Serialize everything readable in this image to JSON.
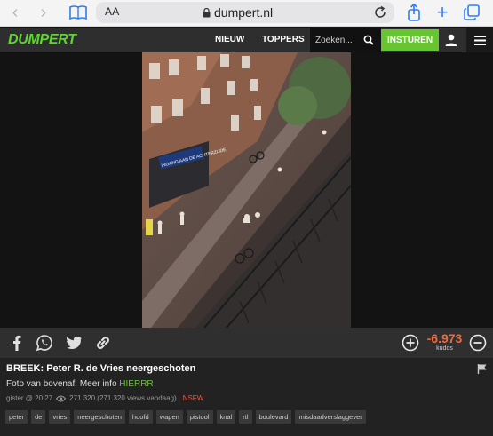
{
  "browser": {
    "text_size_label": "AA",
    "url": "dumpert.nl"
  },
  "header": {
    "logo": "DUMPERT",
    "nav": [
      "NIEUW",
      "TOPPERS"
    ],
    "search_placeholder": "Zoeken...",
    "submit_label": "INSTUREN",
    "accent_color": "#66c531"
  },
  "action_bar": {
    "share_icons": [
      "facebook-icon",
      "whatsapp-icon",
      "twitter-icon",
      "link-icon"
    ],
    "kudos_value": "-6.973",
    "kudos_label": "kudos"
  },
  "post": {
    "title": "BREEK: Peter R. de Vries neergeschoten",
    "description_prefix": "Foto van bovenaf. Meer info ",
    "description_link": "HIERRR",
    "time": "gister @ 20:27",
    "views": "271.320 (271.320 views vandaag)",
    "nsfw": "NSFW",
    "tags": [
      "peter",
      "de",
      "vries",
      "neergeschoten",
      "hoofd",
      "wapen",
      "pistool",
      "knal",
      "rtl",
      "boulevard",
      "misdaadverslaggever"
    ]
  },
  "video_overlay": {
    "sign_text": "INGANG AAN DE ACHTERZIJDE"
  }
}
